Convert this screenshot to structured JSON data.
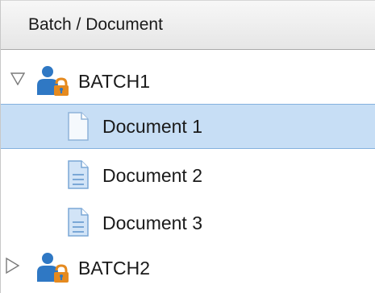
{
  "header": {
    "title": "Batch / Document"
  },
  "tree": {
    "batches": [
      {
        "label": "BATCH1",
        "state": "expanded",
        "icon": "batch-user-lock-icon",
        "documents": [
          {
            "label": "Document 1",
            "icon": "document-icon",
            "selected": true
          },
          {
            "label": "Document 2",
            "icon": "document-icon",
            "selected": false
          },
          {
            "label": "Document 3",
            "icon": "document-icon",
            "selected": false
          }
        ]
      },
      {
        "label": "BATCH2",
        "state": "collapsed",
        "icon": "batch-user-lock-icon",
        "documents": []
      }
    ]
  },
  "colors": {
    "selection_fill": "#c7def5",
    "selection_border": "#84b1de",
    "batch_icon_blue": "#2f78c4",
    "lock_orange": "#e58a1f",
    "document_icon_light": "#d2e4f7",
    "document_icon_line": "#7aa7d6"
  }
}
